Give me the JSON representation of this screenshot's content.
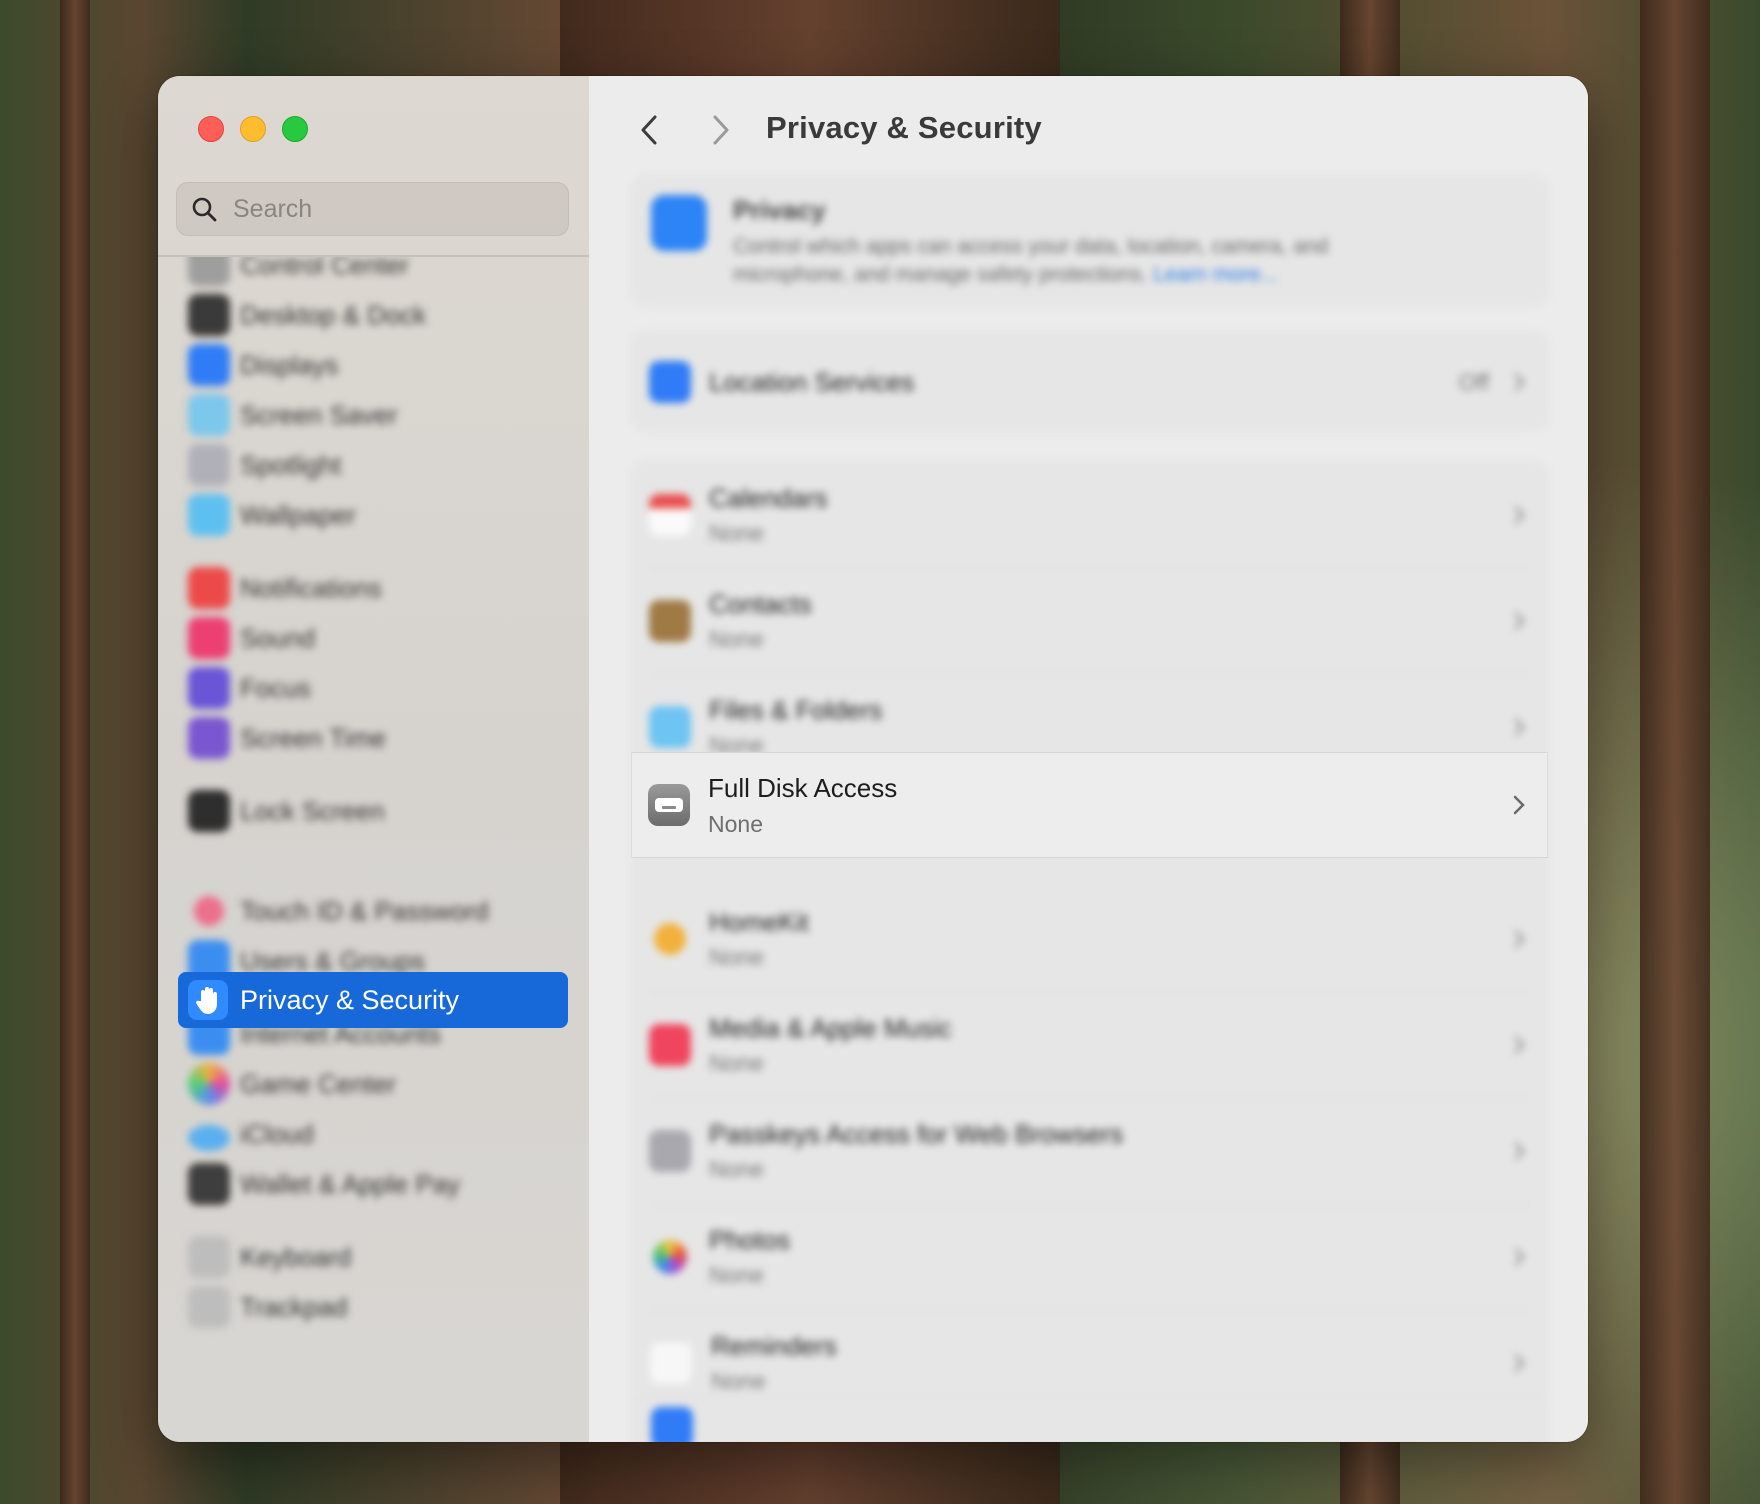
{
  "window": {
    "title": "Privacy & Security"
  },
  "sidebar": {
    "search_placeholder": "Search",
    "selected_label": "Privacy & Security",
    "items": [
      {
        "label": "Control Center",
        "color": "#9e9e9e"
      },
      {
        "label": "Desktop & Dock",
        "color": "#3a3a3a"
      },
      {
        "label": "Displays",
        "color": "#2f7cf6"
      },
      {
        "label": "Screen Saver",
        "color": "#7cc7ec"
      },
      {
        "label": "Spotlight",
        "color": "#b0b0b8"
      },
      {
        "label": "Wallpaper",
        "color": "#5ec0f0"
      },
      {
        "label": "Notifications",
        "color": "#ec4a4a"
      },
      {
        "label": "Sound",
        "color": "#ec3f72"
      },
      {
        "label": "Focus",
        "color": "#6a55d6"
      },
      {
        "label": "Screen Time",
        "color": "#7a56d0"
      },
      {
        "label": "Lock Screen",
        "color": "#2e2e2e"
      },
      {
        "label": "Touch ID & Password",
        "color": "#ec6f8c"
      },
      {
        "label": "Users & Groups",
        "color": "#3b8ef0"
      },
      {
        "label": "Internet Accounts",
        "color": "#3b8ef0"
      },
      {
        "label": "Game Center",
        "color": "#d55ca0"
      },
      {
        "label": "iCloud",
        "color": "#5aaff0"
      },
      {
        "label": "Wallet & Apple Pay",
        "color": "#3e3e3e"
      },
      {
        "label": "Keyboard",
        "color": "#bdbdbd"
      },
      {
        "label": "Trackpad",
        "color": "#bdbdbd"
      }
    ]
  },
  "main": {
    "privacy": {
      "title": "Privacy",
      "description": "Control which apps can access your data, location, camera, and microphone, and manage safety protections.",
      "link": "Learn more..."
    },
    "location": {
      "title": "Location Services",
      "value": "Off"
    },
    "rows": [
      {
        "title": "Calendars",
        "sub": "None",
        "color": "#e85050"
      },
      {
        "title": "Contacts",
        "sub": "None",
        "color": "#a07a45"
      },
      {
        "title": "Files & Folders",
        "sub": "None",
        "color": "#6ec4f2"
      },
      {
        "title": "Full Disk Access",
        "sub": "None",
        "color": "#7d7d7d"
      },
      {
        "title": "HomeKit",
        "sub": "None",
        "color": "#f2b13c"
      },
      {
        "title": "Media & Apple Music",
        "sub": "None",
        "color": "#f0455e"
      },
      {
        "title": "Passkeys Access for Web Browsers",
        "sub": "None",
        "color": "#a8a8ae"
      },
      {
        "title": "Photos",
        "sub": "None",
        "color": "#e56a3a"
      },
      {
        "title": "Reminders",
        "sub": "None",
        "color": "#f4f4f4"
      }
    ]
  }
}
